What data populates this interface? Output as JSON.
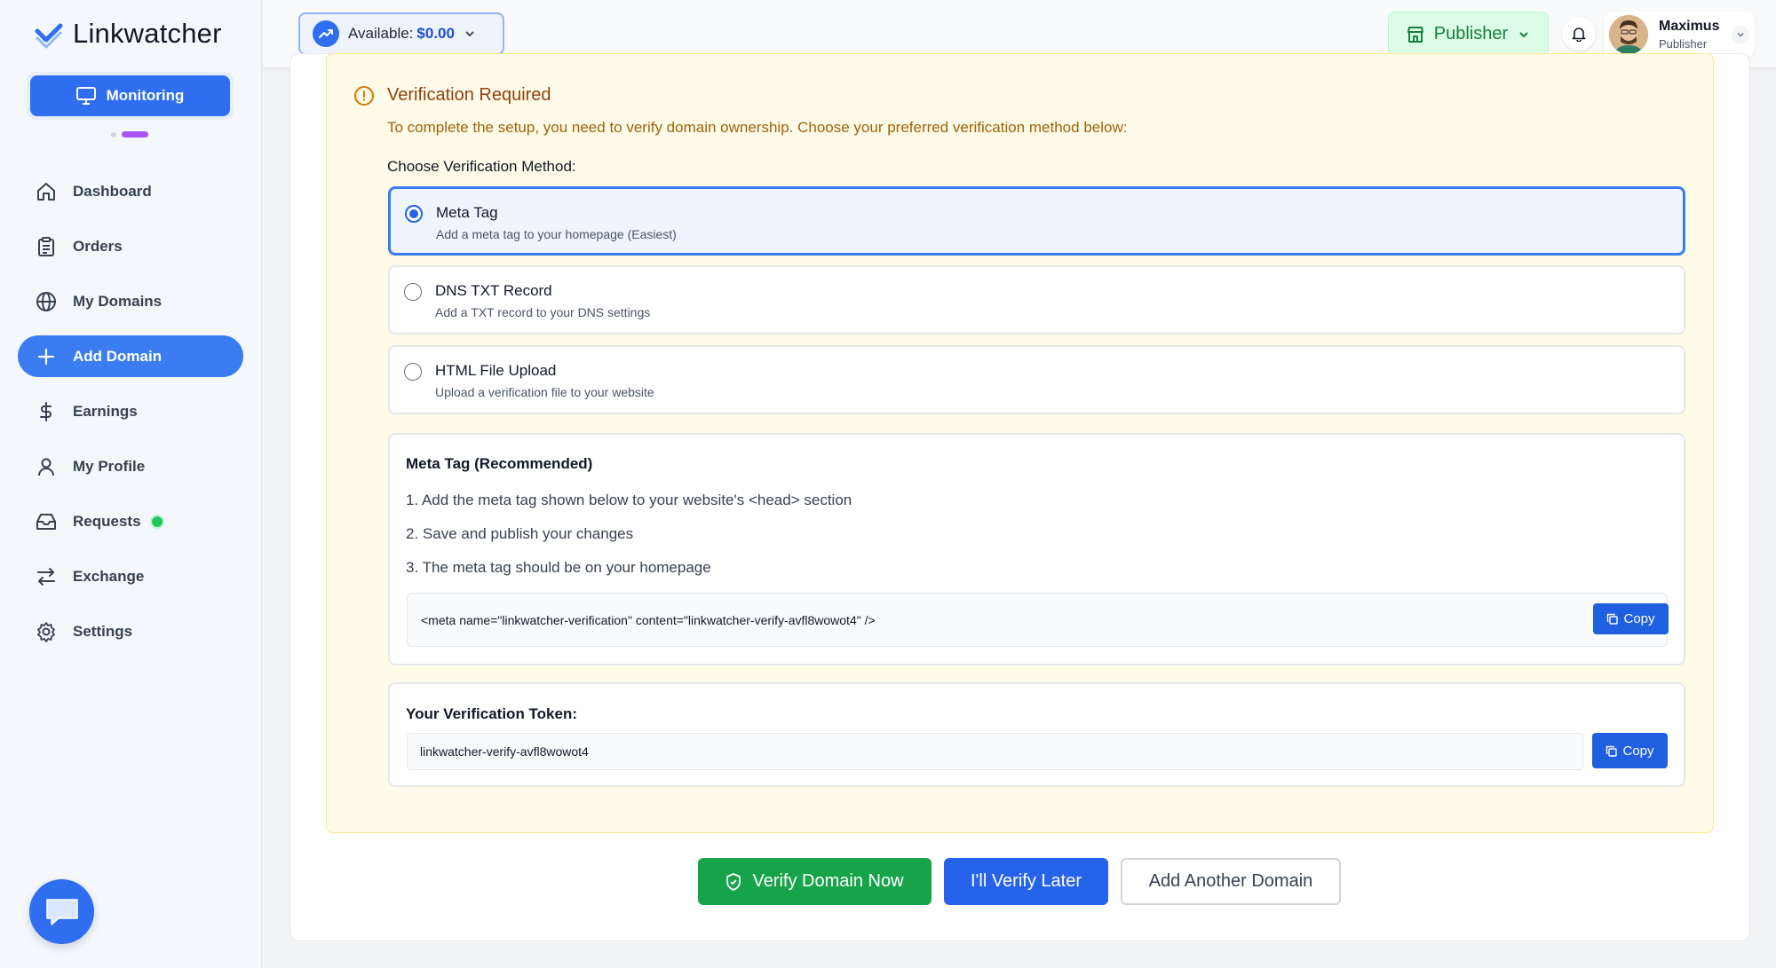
{
  "app": {
    "brand": "Linkwatcher",
    "monitoring_label": "Monitoring"
  },
  "sidebar": {
    "items": [
      {
        "label": "Dashboard",
        "icon": "home-icon"
      },
      {
        "label": "Orders",
        "icon": "clipboard-icon"
      },
      {
        "label": "My Domains",
        "icon": "globe-icon"
      },
      {
        "label": "Add Domain",
        "icon": "plus-icon",
        "active": true
      },
      {
        "label": "Earnings",
        "icon": "dollar-icon"
      },
      {
        "label": "My Profile",
        "icon": "user-icon"
      },
      {
        "label": "Requests",
        "icon": "inbox-icon"
      },
      {
        "label": "Exchange",
        "icon": "exchange-icon"
      },
      {
        "label": "Settings",
        "icon": "gear-icon"
      }
    ]
  },
  "topbar": {
    "available_label": "Available:",
    "available_amount": "$0.00",
    "role_button": "Publisher",
    "user_name": "Maximus",
    "user_role": "Publisher"
  },
  "verification": {
    "title": "Verification Required",
    "subtitle": "To complete the setup, you need to verify domain ownership. Choose your preferred verification method below:",
    "choose_label": "Choose Verification Method:",
    "options": [
      {
        "title": "Meta Tag",
        "desc": "Add a meta tag to your homepage (Easiest)",
        "selected": true
      },
      {
        "title": "DNS TXT Record",
        "desc": "Add a TXT record to your DNS settings",
        "selected": false
      },
      {
        "title": "HTML File Upload",
        "desc": "Upload a verification file to your website",
        "selected": false
      }
    ],
    "meta": {
      "title": "Meta Tag (Recommended)",
      "steps": [
        "1. Add the meta tag shown below to your website's <head> section",
        "2. Save and publish your changes",
        "3. The meta tag should be on your homepage"
      ],
      "code": "<meta name=\"linkwatcher-verification\" content=\"linkwatcher-verify-avfl8wowot4\" />",
      "copy_label": "Copy"
    },
    "token": {
      "label": "Your Verification Token:",
      "value": "linkwatcher-verify-avfl8wowot4",
      "copy_label": "Copy"
    }
  },
  "actions": {
    "verify_now": "Verify Domain Now",
    "verify_later": "I'll Verify Later",
    "add_another": "Add Another Domain"
  },
  "colors": {
    "primary": "#2f6ef0",
    "success": "#16a34a",
    "warning_bg": "#fefbe8",
    "accent_purple": "#a855f7"
  }
}
